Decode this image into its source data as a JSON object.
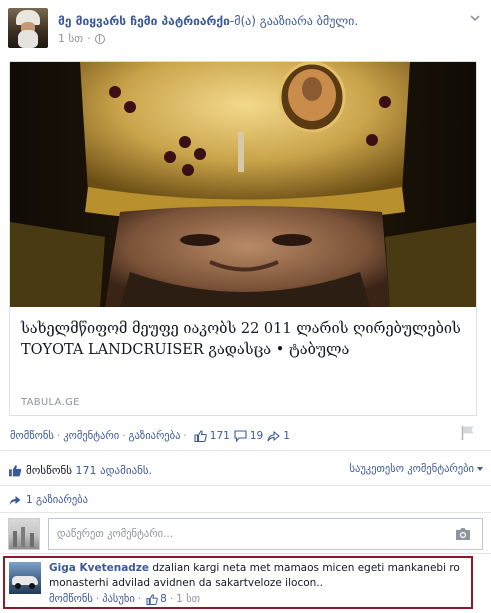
{
  "post": {
    "author": "მე მიყვარს ჩემი პატრიარქი",
    "author_suffix": "-მ(ა) გააზიარა ბმული.",
    "time": "1 სთ",
    "privacy_icon": "globe-icon"
  },
  "link": {
    "title": "სახელმწიფომ მეუფე იაკობს 22 011 ლარის ღირებულების TOYOTA LANDCRUISER გადასცა • ტაბულა",
    "domain": "TABULA.GE"
  },
  "actions": {
    "like": "მომწონს",
    "comment": "კომენტარი",
    "share": "გაზიარება",
    "like_count": "171",
    "comment_count": "19",
    "share_count": "1"
  },
  "summary": {
    "likes_prefix": "მოსწონს",
    "likes_text": "171 ადამიანს.",
    "sort_label": "საუკეთესო კომენტარები",
    "shares_text": "1 გაზიარება"
  },
  "write_comment": {
    "placeholder": "დაწერეთ კომენტარი..."
  },
  "comment": {
    "author": "Giga Kvetenadze",
    "text": "dzalian kargi neta met mamaos micen egeti mankanebi ro monasterhi advilad avidnen da sakartveloze ilocon..",
    "like": "მომწონს",
    "reply": "პასუხი",
    "likes": "8",
    "time": "1 სთ"
  },
  "colors": {
    "link_blue": "#3b5998",
    "meta_gray": "#90949c",
    "highlight_border": "#8b1a2b"
  }
}
